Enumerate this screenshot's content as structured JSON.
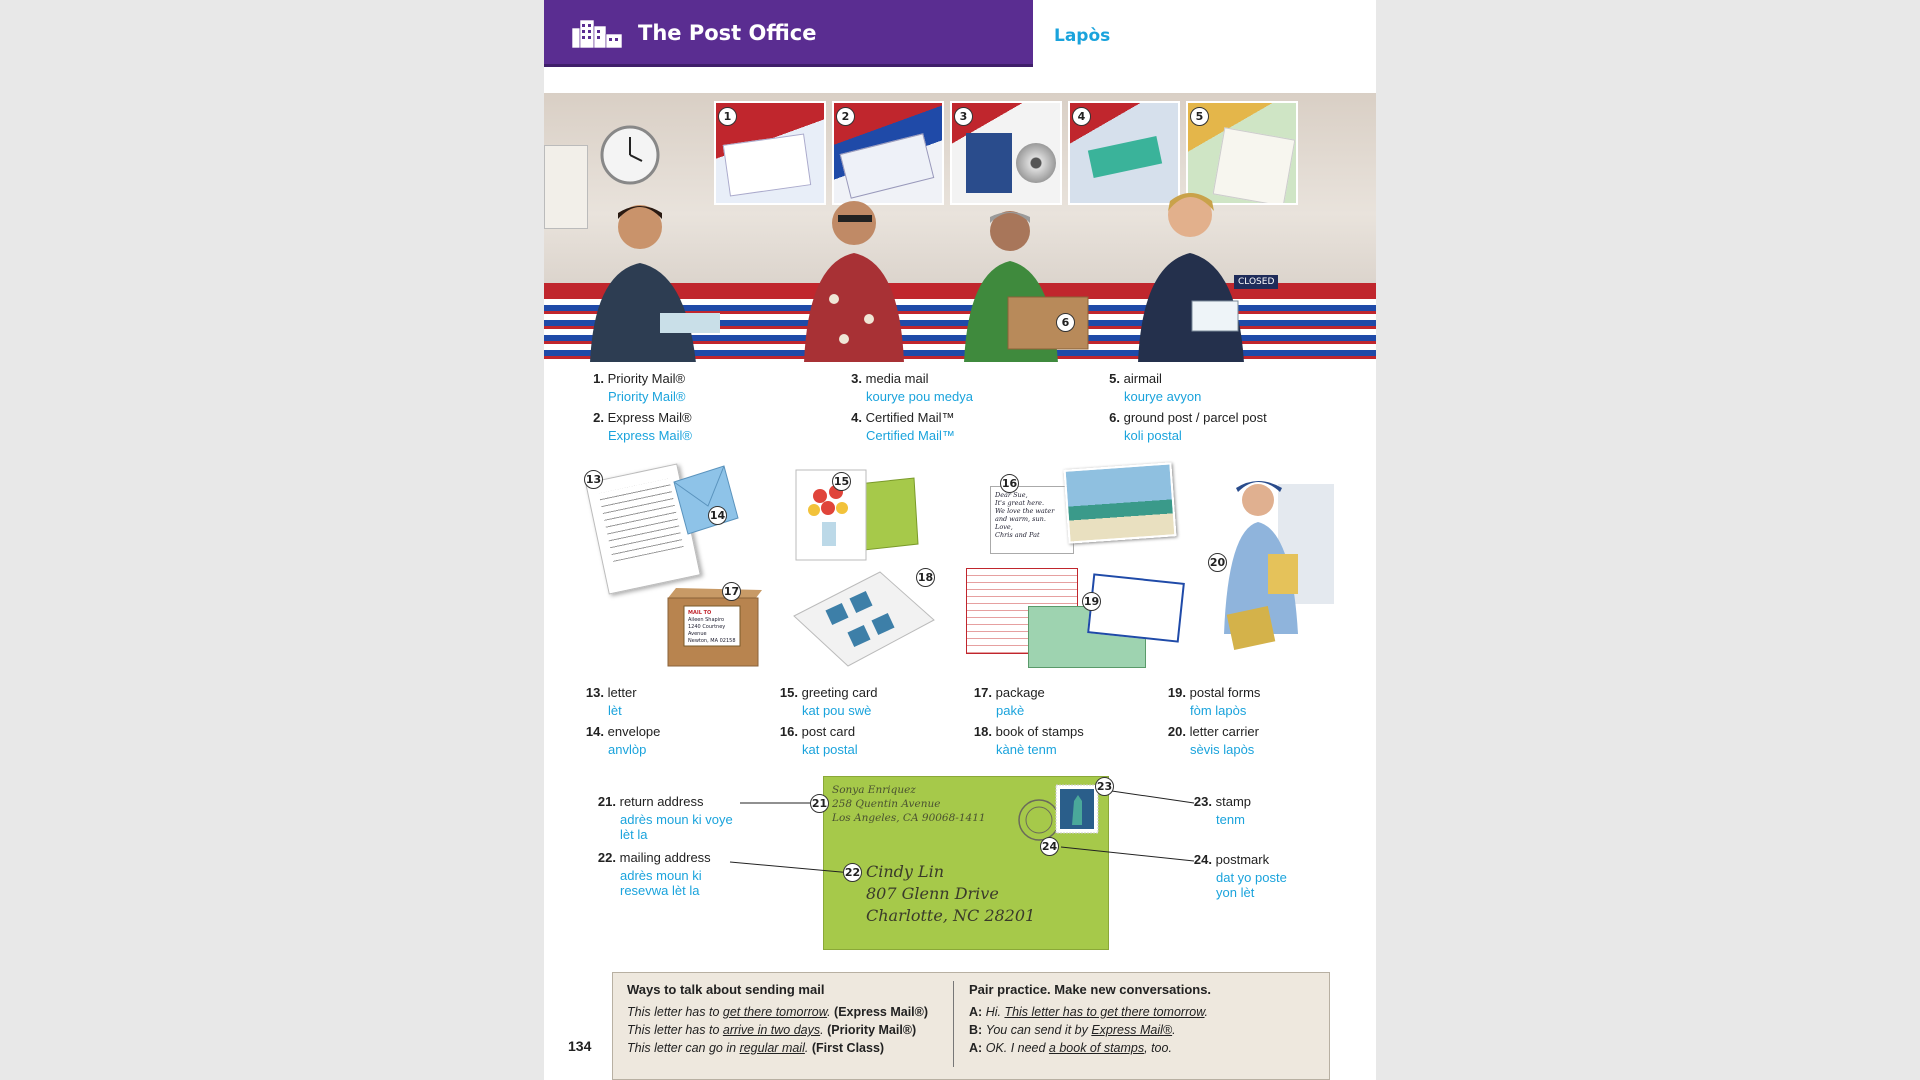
{
  "header": {
    "title": "The Post Office",
    "subtitle": "Lapòs"
  },
  "scene_numbers": [
    "1",
    "2",
    "3",
    "4",
    "5",
    "6"
  ],
  "scene_signs": {
    "closed": "CLOSED"
  },
  "vocab_top": [
    {
      "num": "1.",
      "en": "Priority Mail®",
      "kr": "Priority Mail®"
    },
    {
      "num": "2.",
      "en": "Express Mail®",
      "kr": "Express Mail®"
    },
    {
      "num": "3.",
      "en": "media mail",
      "kr": "kourye pou medya"
    },
    {
      "num": "4.",
      "en": "Certified Mail™",
      "kr": "Certified Mail™"
    },
    {
      "num": "5.",
      "en": "airmail",
      "kr": "kourye avyon"
    },
    {
      "num": "6.",
      "en": "ground post / parcel post",
      "kr": "koli postal"
    }
  ],
  "illus_numbers": [
    "13",
    "14",
    "15",
    "16",
    "17",
    "18",
    "19",
    "20"
  ],
  "vocab_mid": [
    {
      "num": "13.",
      "en": "letter",
      "kr": "lèt"
    },
    {
      "num": "14.",
      "en": "envelope",
      "kr": "anvlòp"
    },
    {
      "num": "15.",
      "en": "greeting card",
      "kr": "kat pou swè"
    },
    {
      "num": "16.",
      "en": "post card",
      "kr": "kat postal"
    },
    {
      "num": "17.",
      "en": "package",
      "kr": "pakè"
    },
    {
      "num": "18.",
      "en": "book of stamps",
      "kr": "kànè tenm"
    },
    {
      "num": "19.",
      "en": "postal forms",
      "kr": "fòm lapòs"
    },
    {
      "num": "20.",
      "en": "letter carrier",
      "kr": "sèvis lapòs"
    }
  ],
  "vocab_env": [
    {
      "num": "21.",
      "en": "return address",
      "kr1": "adrès moun ki voye",
      "kr2": "lèt la"
    },
    {
      "num": "22.",
      "en": "mailing address",
      "kr1": "adrès moun ki",
      "kr2": "resevwa lèt la"
    },
    {
      "num": "23.",
      "en": "stamp",
      "kr1": "tenm",
      "kr2": ""
    },
    {
      "num": "24.",
      "en": "postmark",
      "kr1": "dat yo poste",
      "kr2": "yon lèt"
    }
  ],
  "envelope": {
    "return_lines": [
      "Sonya Enriquez",
      "258 Quentin Avenue",
      "Los Angeles, CA 90068-1411"
    ],
    "mailing_lines": [
      "Cindy Lin",
      "807 Glenn Drive",
      "Charlotte, NC 28201"
    ],
    "callouts": [
      "21",
      "22",
      "23",
      "24"
    ]
  },
  "postcard": {
    "lines": [
      "Dear Sue,",
      "It's great here.",
      "We love the water",
      "and warm, sun.",
      "Love,",
      "Chris and Pat"
    ]
  },
  "package_label": {
    "to": "MAIL TO",
    "lines": [
      "Aileen Shapiro",
      "1240 Courtney Avenue",
      "Newton, MA 02158"
    ]
  },
  "tips": {
    "left_heading": "Ways to talk about sending mail",
    "left_lines": [
      {
        "pre": "This letter has to ",
        "u": "get there tomorrow",
        "post": ". ",
        "bold": "(Express Mail®)"
      },
      {
        "pre": "This letter has to ",
        "u": "arrive in two days",
        "post": ". ",
        "bold": "(Priority Mail®)"
      },
      {
        "pre": "This letter can go in ",
        "u": "regular mail",
        "post": ". ",
        "bold": "(First Class)"
      }
    ],
    "right_heading": "Pair practice. Make new conversations.",
    "right_lines": [
      {
        "spk": "A:",
        "pre": "Hi. ",
        "u": "This letter has to get there tomorrow",
        "post": "."
      },
      {
        "spk": "B:",
        "pre": "You can send it by ",
        "u": "Express Mail®",
        "post": "."
      },
      {
        "spk": "A:",
        "pre": "OK. I need ",
        "u": "a book of stamps",
        "post": ", too."
      }
    ]
  },
  "page_number": "134",
  "colors": {
    "banner": "#5a2d91",
    "accent": "#1aa3dc",
    "envelope": "#a6c94a"
  }
}
